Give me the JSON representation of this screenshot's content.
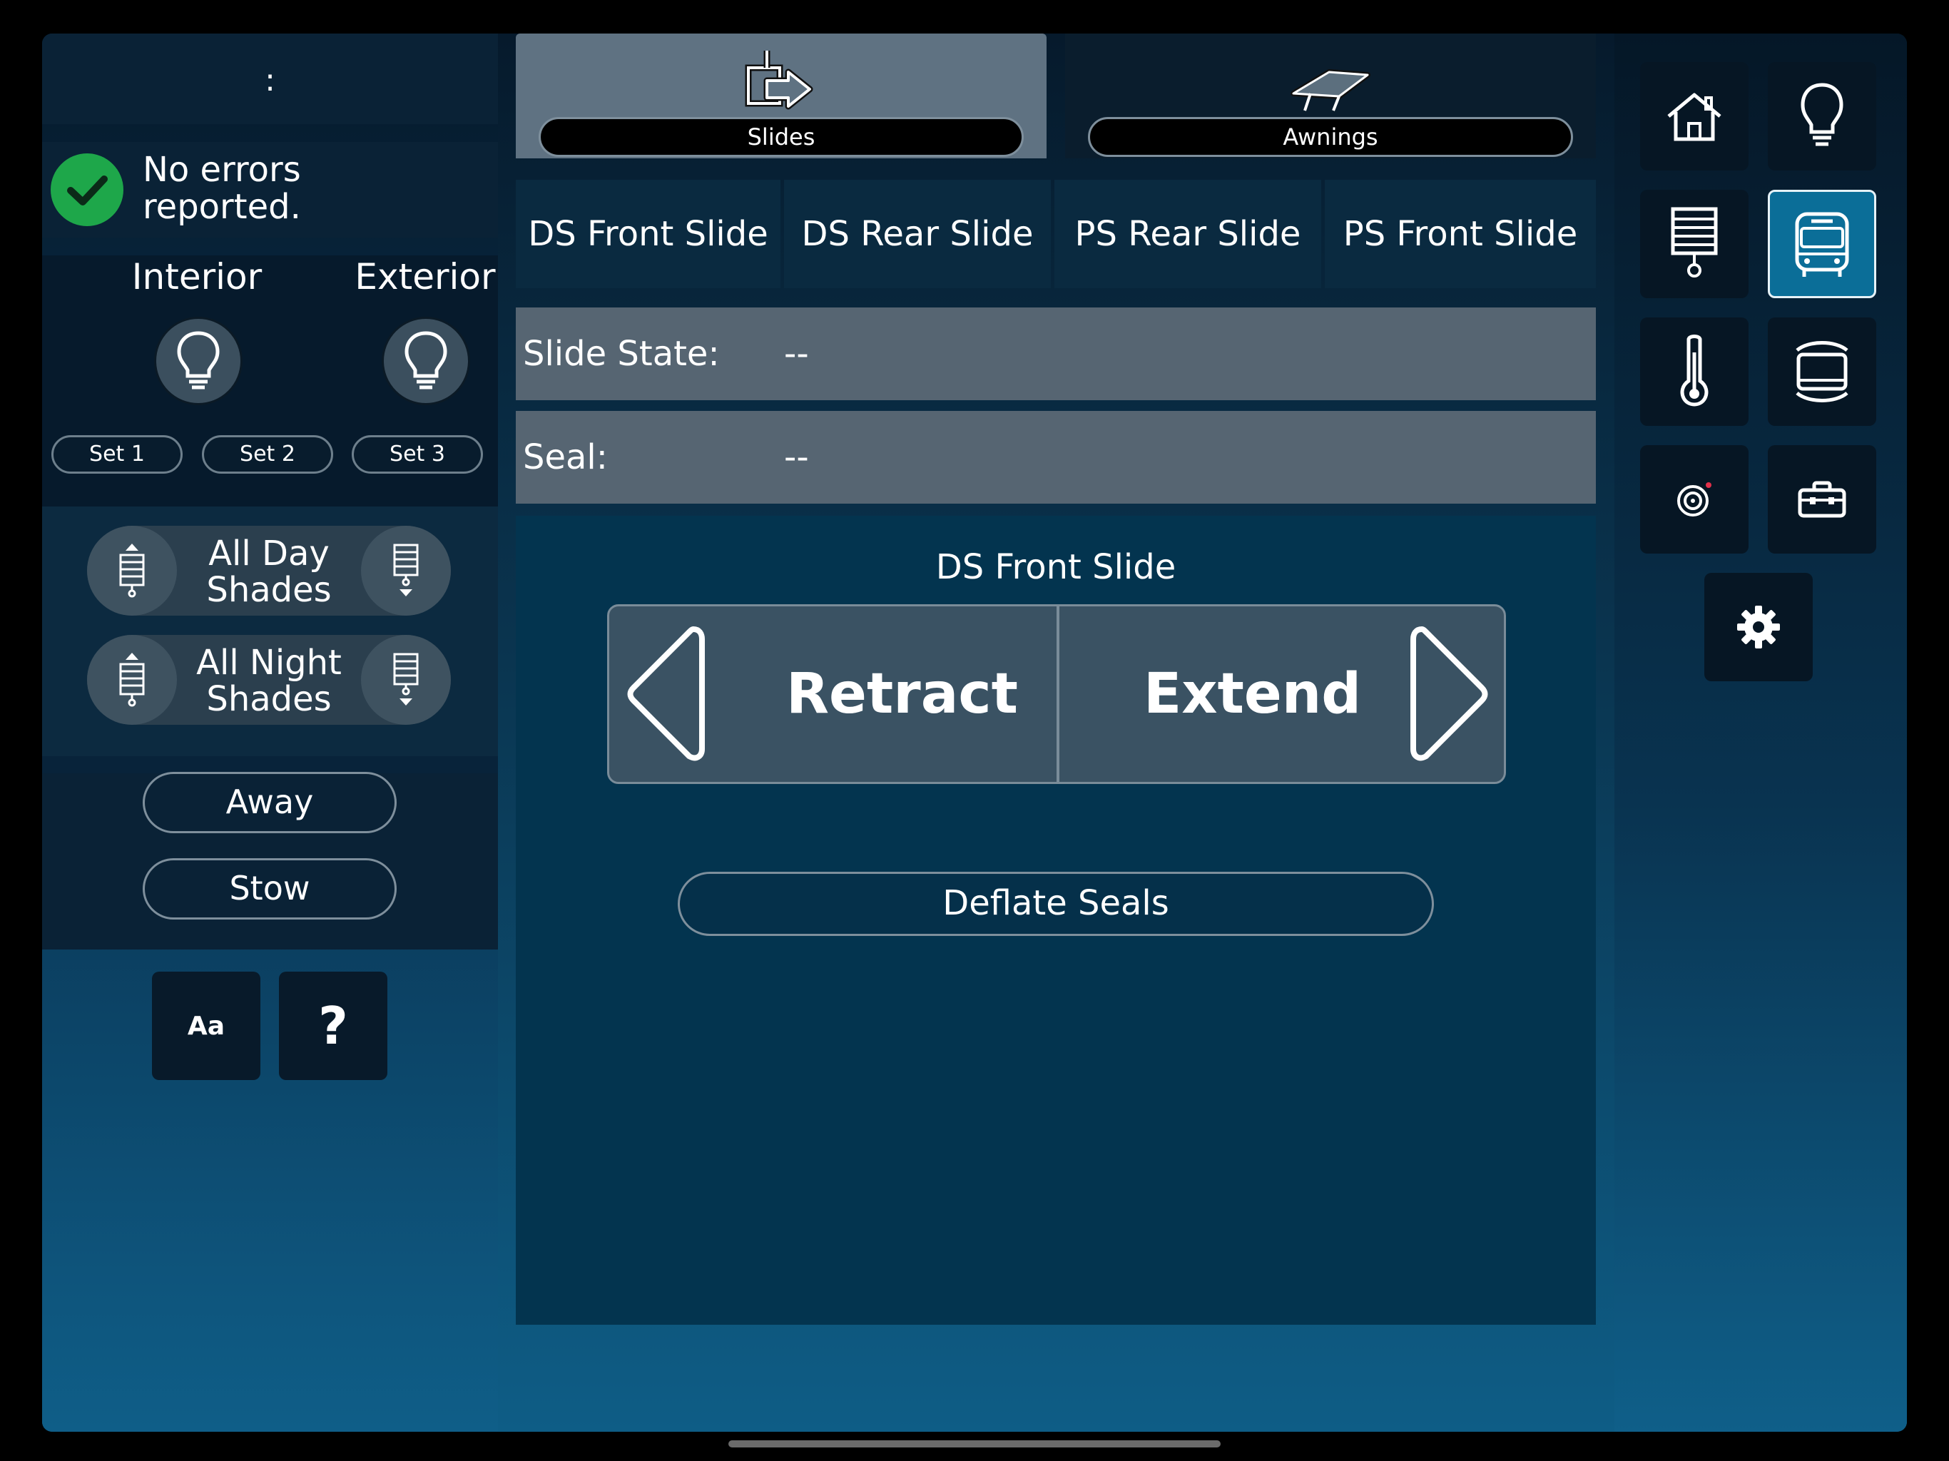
{
  "status": {
    "colon": ":",
    "message_line1": "No errors",
    "message_line2": "reported."
  },
  "lights": {
    "interior_label": "Interior",
    "exterior_label": "Exterior",
    "sets": [
      "Set 1",
      "Set 2",
      "Set 3"
    ]
  },
  "shades": {
    "day_line1": "All Day",
    "day_line2": "Shades",
    "night_line1": "All Night",
    "night_line2": "Shades"
  },
  "modes": {
    "away": "Away",
    "stow": "Stow"
  },
  "tools": {
    "font_label": "Aa",
    "help_label": "?"
  },
  "category_tabs": {
    "slides": "Slides",
    "awnings": "Awnings"
  },
  "slide_tabs": [
    "DS Front Slide",
    "DS Rear Slide",
    "PS Rear Slide",
    "PS Front Slide"
  ],
  "info": {
    "state_label": "Slide State:",
    "state_value": "--",
    "seal_label": "Seal:",
    "seal_value": "--"
  },
  "control": {
    "title": "DS Front Slide",
    "retract": "Retract",
    "extend": "Extend",
    "deflate": "Deflate Seals"
  },
  "nav_icons": [
    "home-icon",
    "lightbulb-icon",
    "shade-icon",
    "coach-icon",
    "thermometer-icon",
    "tank-icon",
    "dial-icon",
    "toolbox-icon",
    "gear-icon"
  ],
  "colors": {
    "accent": "#0b6e98",
    "ok_green": "#1ea74a",
    "row_gray": "#566572"
  }
}
